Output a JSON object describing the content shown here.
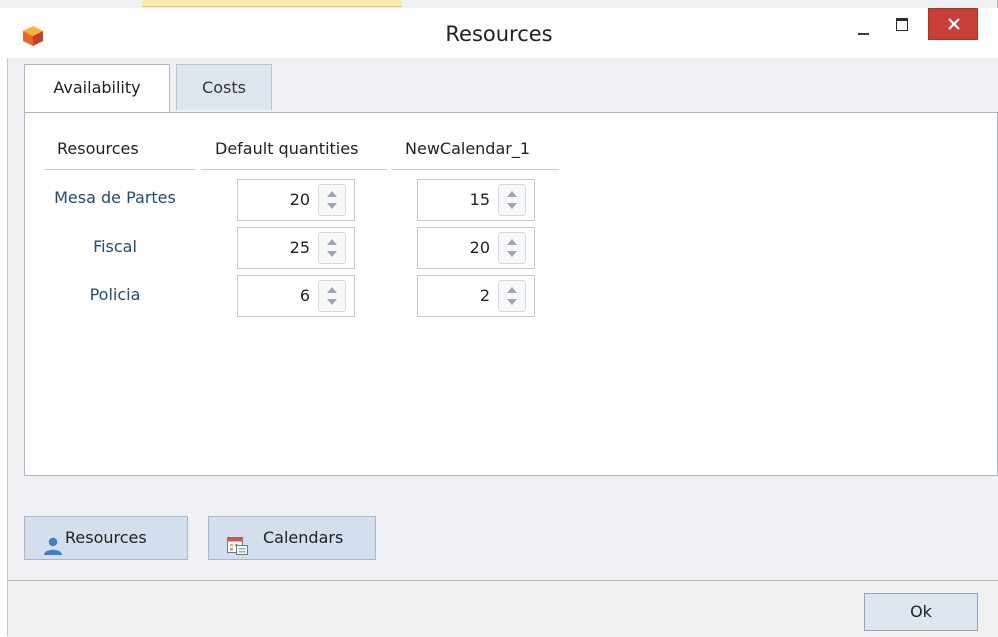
{
  "window": {
    "title": "Resources",
    "colors": {
      "close": "#c7403a",
      "tab_active": "#ffffff",
      "tab_inactive": "#dde5ef",
      "label": "#234a78"
    }
  },
  "tabs": [
    {
      "label": "Availability",
      "active": true
    },
    {
      "label": "Costs",
      "active": false
    }
  ],
  "table": {
    "headers": [
      "Resources",
      "Default quantities",
      "NewCalendar_1"
    ],
    "rows": [
      {
        "name": "Mesa de Partes",
        "default": "20",
        "calendar": "15"
      },
      {
        "name": "Fiscal",
        "default": "25",
        "calendar": "20"
      },
      {
        "name": "Policia",
        "default": "6",
        "calendar": "2"
      }
    ]
  },
  "buttons": {
    "resources_label": "Resources",
    "calendars_label": "Calendars",
    "ok_label": "Ok"
  },
  "icons": {
    "app": "app-cube-icon",
    "minimize": "minimize-icon",
    "maximize": "maximize-icon",
    "close": "close-icon",
    "resources": "user-icon",
    "calendars": "calendar-icon"
  }
}
